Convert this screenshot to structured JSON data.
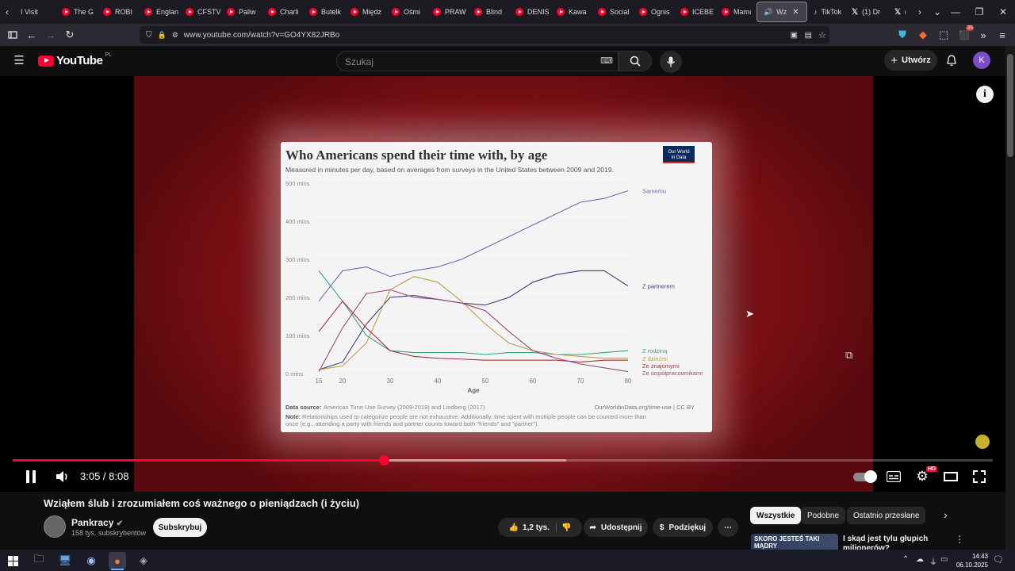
{
  "browser": {
    "tabs": [
      {
        "label": "I Visit"
      },
      {
        "label": "The G"
      },
      {
        "label": "ROBI"
      },
      {
        "label": "Englan"
      },
      {
        "label": "CFSTV"
      },
      {
        "label": "Paliw"
      },
      {
        "label": "Charli"
      },
      {
        "label": "Butelk"
      },
      {
        "label": "Międz"
      },
      {
        "label": "Ośmi"
      },
      {
        "label": "PRAW"
      },
      {
        "label": "Blind"
      },
      {
        "label": "DENIS"
      },
      {
        "label": "Kawa"
      },
      {
        "label": "Social"
      },
      {
        "label": "Ognis"
      },
      {
        "label": "ICEBE"
      },
      {
        "label": "Mamı"
      }
    ],
    "active_tab": "Wz",
    "other_tabs": [
      {
        "label": "TikTok"
      },
      {
        "label": "(1) Dr"
      }
    ],
    "url": "www.youtube.com/watch?v=GO4YX82JRBo",
    "extension_badge": "35"
  },
  "youtube": {
    "logo_text": "YouTube",
    "region": "PL",
    "search_placeholder": "Szukaj",
    "create_label": "Utwórz",
    "avatar_letter": "K"
  },
  "player": {
    "current_time": "3:05",
    "duration": "8:08",
    "time_display": "3:05 / 8:08",
    "progress_fraction": 0.379,
    "buffered_fraction": 0.565,
    "quality_badge": "HD"
  },
  "slide": {
    "title": "Who Americans spend their time with, by age",
    "subtitle": "Measured in minutes per day, based on averages from surveys in the United States between 2009 and 2019.",
    "logo_line1": "Our World",
    "logo_line2": "in Data",
    "source_label": "Data source:",
    "source_text": "American Time Use Survey (2009-2019) and Lindberg (2017)",
    "source_url": "OurWorldinData.org/time-use | CC BY",
    "note_label": "Note:",
    "note_line1": "Relationships used to categorize people are not exhaustive. Additionally, time spent with multiple people can be counted more than",
    "note_line2": "once (e.g., attending a party with friends and partner counts toward both \"friends\" and \"partner\")."
  },
  "chart_data": {
    "type": "line",
    "title": "Who Americans spend their time with, by age",
    "xlabel": "Age",
    "ylabel": "",
    "xlim": [
      15,
      80
    ],
    "ylim": [
      0,
      500
    ],
    "x_ticks": [
      15,
      20,
      30,
      40,
      50,
      60,
      70,
      80
    ],
    "y_ticks": [
      0,
      100,
      200,
      300,
      400,
      500
    ],
    "y_tick_labels": [
      "0 mins",
      "100 mins",
      "200 mins",
      "300 mins",
      "400 mins",
      "500 mins"
    ],
    "grid": true,
    "legend": "inline-right",
    "x": [
      15,
      20,
      25,
      30,
      35,
      40,
      45,
      50,
      55,
      60,
      65,
      70,
      75,
      80
    ],
    "series": [
      {
        "name": "Samemu",
        "color": "#6b6baf",
        "values": [
          190,
          270,
          280,
          255,
          270,
          280,
          300,
          330,
          360,
          390,
          420,
          450,
          460,
          480
        ]
      },
      {
        "name": "Z partnerem",
        "color": "#3f3f7f",
        "values": [
          10,
          30,
          130,
          200,
          205,
          195,
          185,
          180,
          200,
          240,
          260,
          270,
          270,
          230
        ]
      },
      {
        "name": "Z rodziną",
        "color": "#3fa08c",
        "values": [
          270,
          190,
          100,
          60,
          55,
          55,
          55,
          50,
          55,
          55,
          50,
          50,
          55,
          60
        ]
      },
      {
        "name": "Z dziećmi",
        "color": "#b8a04a",
        "values": [
          10,
          20,
          80,
          220,
          255,
          240,
          190,
          130,
          80,
          60,
          50,
          45,
          40,
          40
        ]
      },
      {
        "name": "Ze znajomymi",
        "color": "#a8323a",
        "values": [
          110,
          190,
          120,
          60,
          45,
          40,
          38,
          35,
          35,
          35,
          35,
          30,
          35,
          35
        ]
      },
      {
        "name": "Ze współpracownikami",
        "color": "#9a4a7a",
        "values": [
          5,
          120,
          210,
          220,
          200,
          195,
          185,
          165,
          110,
          60,
          40,
          25,
          15,
          5
        ]
      }
    ]
  },
  "video": {
    "title": "Wziąłem ślub i zrozumiałem coś ważnego o pieniądzach (i życiu)",
    "channel": "Pankracy",
    "subscribers": "158 tys. subskrybentów",
    "subscribe_label": "Subskrybuj",
    "likes": "1,2 tys.",
    "share_label": "Udostępnij",
    "thanks_label": "Podziękuj"
  },
  "related": {
    "chips": [
      {
        "label": "Wszystkie"
      },
      {
        "label": "Podobne"
      },
      {
        "label": "Ostatnio przesłane"
      }
    ],
    "first_title": "I skąd jest tylu głupich milionerów?",
    "first_thumb_text": "SKORO JESTEŚ TAKI MĄDRY"
  },
  "taskbar": {
    "time": "14:43",
    "date": "06.10.2025"
  }
}
